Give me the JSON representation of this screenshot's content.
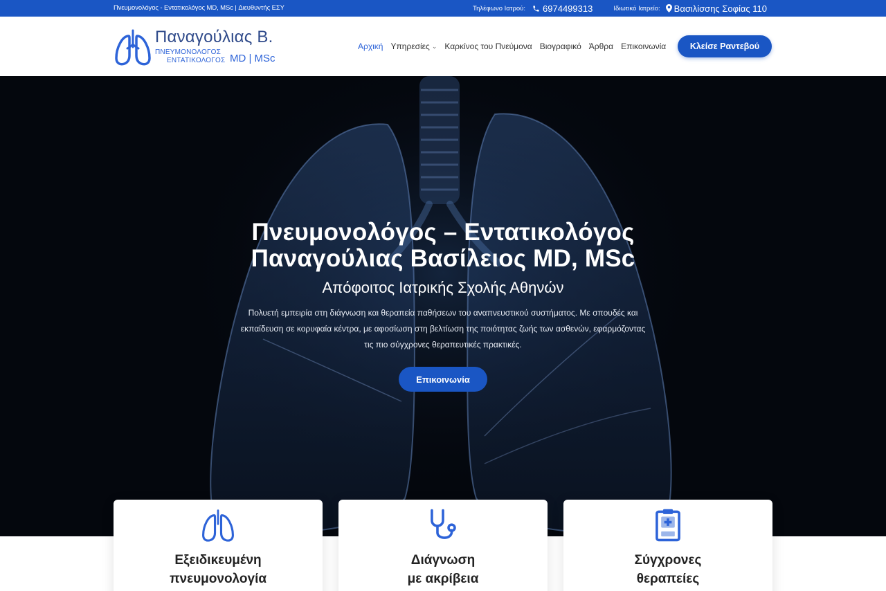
{
  "topbar": {
    "tagline": "Πνευμονολόγος - Εντατικολόγος MD, MSc | Διευθυντής ΕΣΥ",
    "phone_label": "Τηλέφωνο Ιατρού:",
    "phone": "6974499313",
    "address_label": "Ιδιωτικό Ιατρείο:",
    "address": "Βασιλίσσης Σοφίας 110"
  },
  "logo": {
    "name": "Παναγούλιας Β.",
    "specialty_1": "ΠΝΕΥΜΟΝΟΛΟΓΟΣ",
    "specialty_2": "ΕΝΤΑΤΙΚΟΛΟΓΟΣ",
    "degrees": "MD | MSc"
  },
  "nav": {
    "items": [
      {
        "label": "Αρχική"
      },
      {
        "label": "Υπηρεσίες"
      },
      {
        "label": "Καρκίνος του Πνεύμονα"
      },
      {
        "label": "Βιογραφικό"
      },
      {
        "label": "Άρθρα"
      },
      {
        "label": "Επικοινωνία"
      }
    ],
    "book_label": "Κλείσε Ραντεβού"
  },
  "hero": {
    "title_line1": "Πνευμονολόγος – Εντατικολόγος",
    "title_line2": "Παναγούλιας Βασίλειος MD, MSc",
    "subtitle": "Απόφοιτος Ιατρικής Σχολής Αθηνών",
    "description": "Πολυετή εμπειρία στη διάγνωση και θεραπεία παθήσεων του αναπνευστικού συστήματος. Με σπουδές και εκπαίδευση σε κορυφαία κέντρα, με αφοσίωση στη βελτίωση της ποιότητας ζωής των ασθενών, εφαρμόζοντας τις πιο σύγχρονες θεραπευτικές πρακτικές.",
    "button_label": "Επικοινωνία"
  },
  "features": [
    {
      "line1": "Εξειδικευμένη",
      "line2": "πνευμονολογία",
      "icon": "lungs-icon"
    },
    {
      "line1": "Διάγνωση",
      "line2": "με ακρίβεια",
      "icon": "stethoscope-icon"
    },
    {
      "line1": "Σύγχρονες",
      "line2": "θεραπείες",
      "icon": "clipboard-medical-icon"
    }
  ],
  "colors": {
    "primary": "#1a56c4",
    "hero_bg": "#04070d",
    "accent_text": "#2d63d8"
  }
}
